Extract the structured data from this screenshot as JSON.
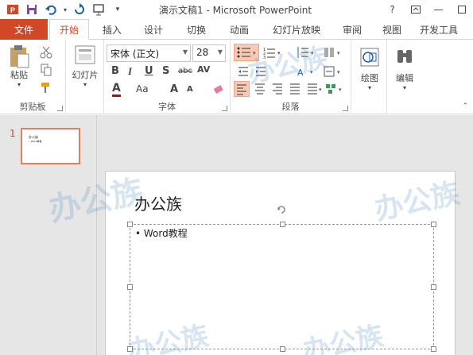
{
  "window": {
    "title": "演示文稿1 - Microsoft PowerPoint",
    "help": "?",
    "minimize": "—",
    "close": "✕"
  },
  "tabs": {
    "file": "文件",
    "items": [
      "开始",
      "插入",
      "设计",
      "切换",
      "动画",
      "幻灯片放映",
      "审阅",
      "视图",
      "开发工具"
    ]
  },
  "ribbon": {
    "clipboard": {
      "label": "剪贴板",
      "paste": "粘贴"
    },
    "slides": {
      "label": "幻灯片",
      "new_slide": "幻灯片"
    },
    "font": {
      "label": "字体",
      "font_name": "宋体 (正文)",
      "font_size": "28",
      "bold": "B",
      "italic": "I",
      "underline": "U",
      "shadow": "S",
      "strike": "abc",
      "spacing": "AV",
      "color": "A",
      "case": "Aa",
      "grow": "A",
      "shrink": "A"
    },
    "paragraph": {
      "label": "段落"
    },
    "drawing": {
      "label": "绘图",
      "btn": "绘图"
    },
    "editing": {
      "label": "编辑",
      "btn": "编辑"
    }
  },
  "thumbs": [
    {
      "num": "1",
      "title": "办公族",
      "body": "• Word教程"
    }
  ],
  "slide": {
    "title": "办公族",
    "bullet": "• Word教程"
  },
  "colors": {
    "accent": "#d24726",
    "highlight": "#f9c9b6"
  }
}
